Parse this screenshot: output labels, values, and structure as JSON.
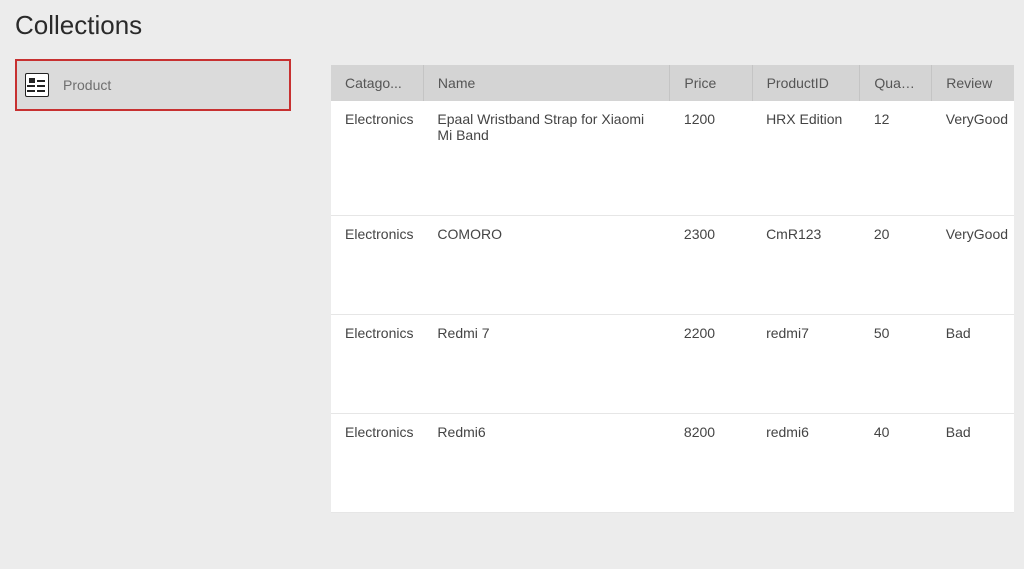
{
  "title": "Collections",
  "sidebar": {
    "items": [
      {
        "label": "Product"
      }
    ]
  },
  "table": {
    "headers": {
      "category": "Catago...",
      "name": "Name",
      "price": "Price",
      "productid": "ProductID",
      "quantity": "Quan...",
      "review": "Review"
    },
    "rows": [
      {
        "category": "Electronics",
        "name": "Epaal Wristband Strap for Xiaomi Mi Band",
        "price": "1200",
        "productid": "HRX Edition",
        "quantity": "12",
        "review": "VeryGood"
      },
      {
        "category": "Electronics",
        "name": "COMORO",
        "price": "2300",
        "productid": "CmR123",
        "quantity": "20",
        "review": "VeryGood"
      },
      {
        "category": "Electronics",
        "name": "Redmi 7",
        "price": "2200",
        "productid": "redmi7",
        "quantity": "50",
        "review": "Bad"
      },
      {
        "category": "Electronics",
        "name": "Redmi6",
        "price": "8200",
        "productid": "redmi6",
        "quantity": "40",
        "review": "Bad"
      }
    ]
  }
}
